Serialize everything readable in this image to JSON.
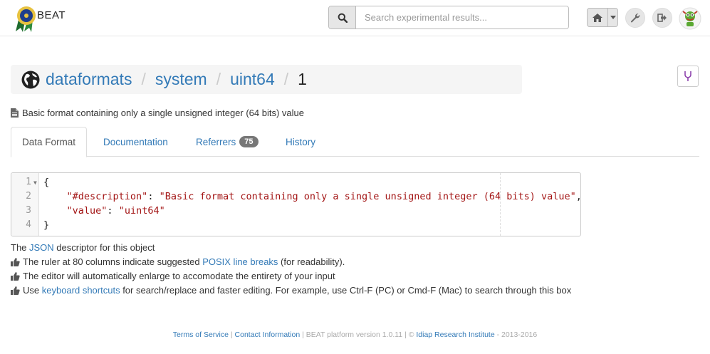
{
  "brand": {
    "name": "BEAT"
  },
  "search": {
    "placeholder": "Search experimental results..."
  },
  "nav_icons": [
    "search-icon",
    "home-icon",
    "caret-down-icon",
    "wrench-icon",
    "logout-icon",
    "user-avatar"
  ],
  "breadcrumb": {
    "items": [
      "dataformats",
      "system",
      "uint64"
    ],
    "version": "1",
    "separator": "/"
  },
  "description": "Basic format containing only a single unsigned integer (64 bits) value",
  "tabs": [
    {
      "label": "Data Format"
    },
    {
      "label": "Documentation"
    },
    {
      "label": "Referrers",
      "badge": "75"
    },
    {
      "label": "History"
    }
  ],
  "editor": {
    "line_numbers": [
      "1",
      "2",
      "3",
      "4"
    ],
    "lines": [
      "{",
      "    \"#description\": \"Basic format containing only a single unsigned integer (64 bits) value\",",
      "    \"value\": \"uint64\"",
      "}"
    ],
    "desc_key": "\"#description\"",
    "desc_value": "\"Basic format containing only a single unsigned integer (64 bits) value\"",
    "value_key": "\"value\"",
    "value_value": "\"uint64\""
  },
  "help": {
    "line1_pre": "The ",
    "line1_link": "JSON",
    "line1_post": " descriptor for this object",
    "line2_pre": "The ruler at 80 columns indicate suggested ",
    "line2_link": "POSIX line breaks",
    "line2_post": " (for readability).",
    "line3": "The editor will automatically enlarge to accomodate the entirety of your input",
    "line4_pre": "Use ",
    "line4_link": "keyboard shortcuts",
    "line4_post": " for search/replace and faster editing. For example, use Ctrl-F (PC) or Cmd-F (Mac) to search through this box"
  },
  "footer": {
    "terms": "Terms of Service",
    "sep1": " | ",
    "contact": "Contact Information",
    "version_text": " | BEAT platform version 1.0.11 | © ",
    "institute": "Idiap Research Institute",
    "years": " - 2013-2016"
  },
  "colors": {
    "link": "#337ab7",
    "string": "#a31515",
    "badge": "#777777"
  }
}
